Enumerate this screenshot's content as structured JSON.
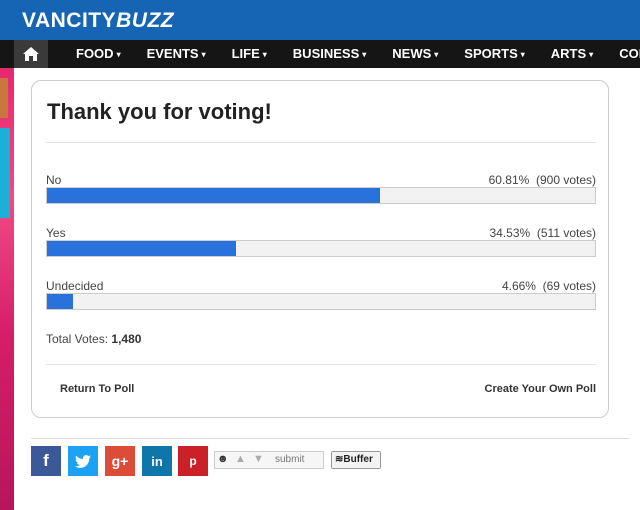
{
  "site": {
    "logo": "VANCITY",
    "logo_accent": "BUZZ"
  },
  "nav": {
    "home_icon": "home-icon",
    "items": [
      {
        "label": "FOOD"
      },
      {
        "label": "EVENTS"
      },
      {
        "label": "LIFE"
      },
      {
        "label": "BUSINESS"
      },
      {
        "label": "NEWS"
      },
      {
        "label": "SPORTS"
      },
      {
        "label": "ARTS"
      },
      {
        "label": "CONT"
      }
    ],
    "caret": "▾"
  },
  "poll": {
    "title": "Thank you for voting!",
    "answers": [
      {
        "label": "No",
        "percent": "60.81%",
        "votes": "(900 votes)",
        "fraction": 0.6081
      },
      {
        "label": "Yes",
        "percent": "34.53%",
        "votes": "(511 votes)",
        "fraction": 0.3453
      },
      {
        "label": "Undecided",
        "percent": "4.66%",
        "votes": "(69 votes)",
        "fraction": 0.0466
      }
    ],
    "total_label": "Total Votes:",
    "total_value": "1,480",
    "return_link": "Return To Poll",
    "create_link": "Create Your Own Poll"
  },
  "share": {
    "facebook": "f",
    "twitter_icon": "twitter-icon",
    "google_plus": "g+",
    "linkedin": "in",
    "pinterest": "p",
    "reddit_submit": "submit",
    "buffer": "Buffer"
  },
  "colors": {
    "header": "#1565b4",
    "nav": "#151515",
    "bar": "#2a72db",
    "facebook": "#3b5998",
    "twitter": "#1da1f2",
    "google": "#dd4b39",
    "linkedin": "#0e76a8",
    "pinterest": "#cb2027"
  }
}
